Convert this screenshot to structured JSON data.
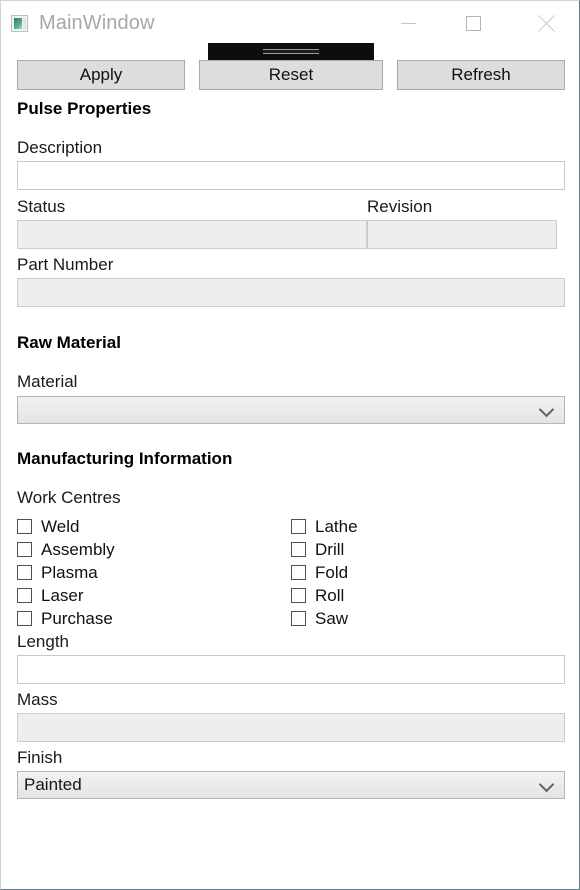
{
  "window": {
    "title": "MainWindow",
    "icon": "app-window-icon",
    "controls": {
      "minimize": "minimize-icon",
      "maximize": "maximize-icon",
      "close": "close-icon"
    }
  },
  "toolbar": {
    "handle": "drag-grip-handle",
    "buttons": [
      {
        "label": "Apply"
      },
      {
        "label": "Reset"
      },
      {
        "label": "Refresh"
      }
    ]
  },
  "sections": {
    "pulse_properties": {
      "title": "Pulse Properties",
      "fields": {
        "description": {
          "label": "Description",
          "value": "",
          "enabled": true
        },
        "status": {
          "label": "Status",
          "value": "",
          "enabled": false
        },
        "revision": {
          "label": "Revision",
          "value": "",
          "enabled": false
        },
        "part_number": {
          "label": "Part Number",
          "value": "",
          "enabled": false
        }
      }
    },
    "raw_material": {
      "title": "Raw Material",
      "fields": {
        "material": {
          "label": "Material",
          "value": "",
          "chevron": "chevron-down-icon"
        }
      }
    },
    "manufacturing_information": {
      "title": "Manufacturing Information",
      "work_centres": {
        "label": "Work Centres",
        "left_column": [
          {
            "label": "Weld",
            "checked": false
          },
          {
            "label": "Assembly",
            "checked": false
          },
          {
            "label": "Plasma",
            "checked": false
          },
          {
            "label": "Laser",
            "checked": false
          },
          {
            "label": "Purchase",
            "checked": false
          }
        ],
        "right_column": [
          {
            "label": "Lathe",
            "checked": false
          },
          {
            "label": "Drill",
            "checked": false
          },
          {
            "label": "Fold",
            "checked": false
          },
          {
            "label": "Roll",
            "checked": false
          },
          {
            "label": "Saw",
            "checked": false
          }
        ]
      },
      "fields": {
        "length": {
          "label": "Length",
          "value": "",
          "enabled": true
        },
        "mass": {
          "label": "Mass",
          "value": "",
          "enabled": false
        },
        "finish": {
          "label": "Finish",
          "value": "Painted",
          "chevron": "chevron-down-icon"
        }
      }
    }
  },
  "colors": {
    "window_border": "#5b7c84",
    "title_text": "#a2a8ab",
    "button_face": "#dddddd",
    "disabled_field": "#eeeeee",
    "toolbar_dark": "#0d0d0d",
    "icon_accent": "#54a884"
  }
}
